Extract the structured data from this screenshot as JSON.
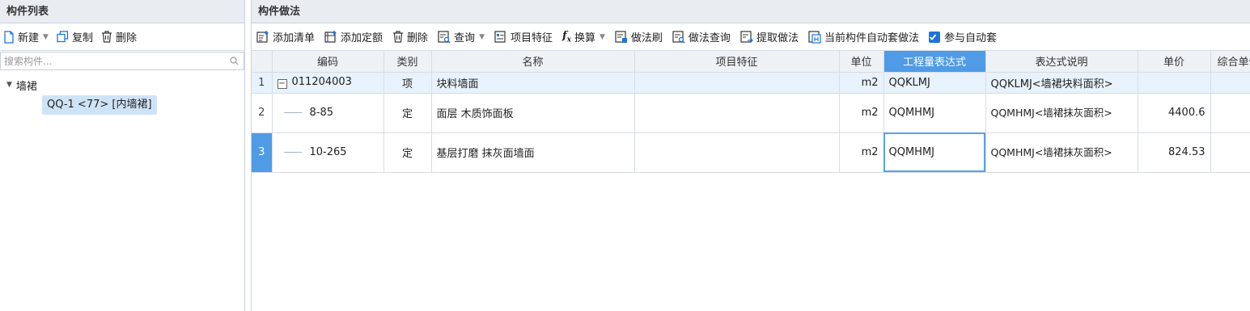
{
  "left_panel": {
    "title": "构件列表",
    "toolbar": {
      "new_label": "新建",
      "copy_label": "复制",
      "delete_label": "删除"
    },
    "search": {
      "placeholder": "搜索构件..."
    },
    "tree": {
      "group_label": "墙裙",
      "item_label": "QQ-1 <77> [内墙裙]"
    }
  },
  "right_panel": {
    "title": "构件做法",
    "toolbar": {
      "add_list": "添加清单",
      "add_quota": "添加定额",
      "delete": "删除",
      "query": "查询",
      "item_feature": "项目特征",
      "convert": "换算",
      "method_brush": "做法刷",
      "method_query": "做法查询",
      "extract_method": "提取做法",
      "auto_apply": "当前构件自动套做法",
      "participate_auto": "参与自动套"
    },
    "table": {
      "headers": [
        "编码",
        "类别",
        "名称",
        "项目特征",
        "单位",
        "工程量表达式",
        "表达式说明",
        "单价",
        "综合单价"
      ],
      "rows": [
        {
          "num": "1",
          "code": "011204003",
          "type": "项",
          "name": "块料墙面",
          "feature": "",
          "unit": "m2",
          "expr": "QQKLMJ",
          "expr_desc": "QQKLMJ<墙裙块料面积>",
          "price": ""
        },
        {
          "num": "2",
          "code": "8-85",
          "type": "定",
          "name": "面层 木质饰面板",
          "feature": "",
          "unit": "m2",
          "expr": "QQMHMJ",
          "expr_desc": "QQMHMJ<墙裙抹灰面积>",
          "price": "4400.6"
        },
        {
          "num": "3",
          "code": "10-265",
          "type": "定",
          "name": "基层打磨 抹灰面墙面",
          "feature": "",
          "unit": "m2",
          "expr": "QQMHMJ",
          "expr_desc": "QQMHMJ<墙裙抹灰面积>",
          "price": "824.53"
        }
      ]
    }
  },
  "colors": {
    "accent": "#4f9be6",
    "selected_row": "#e8f2fc",
    "tree_selected": "#cfe3f7"
  }
}
